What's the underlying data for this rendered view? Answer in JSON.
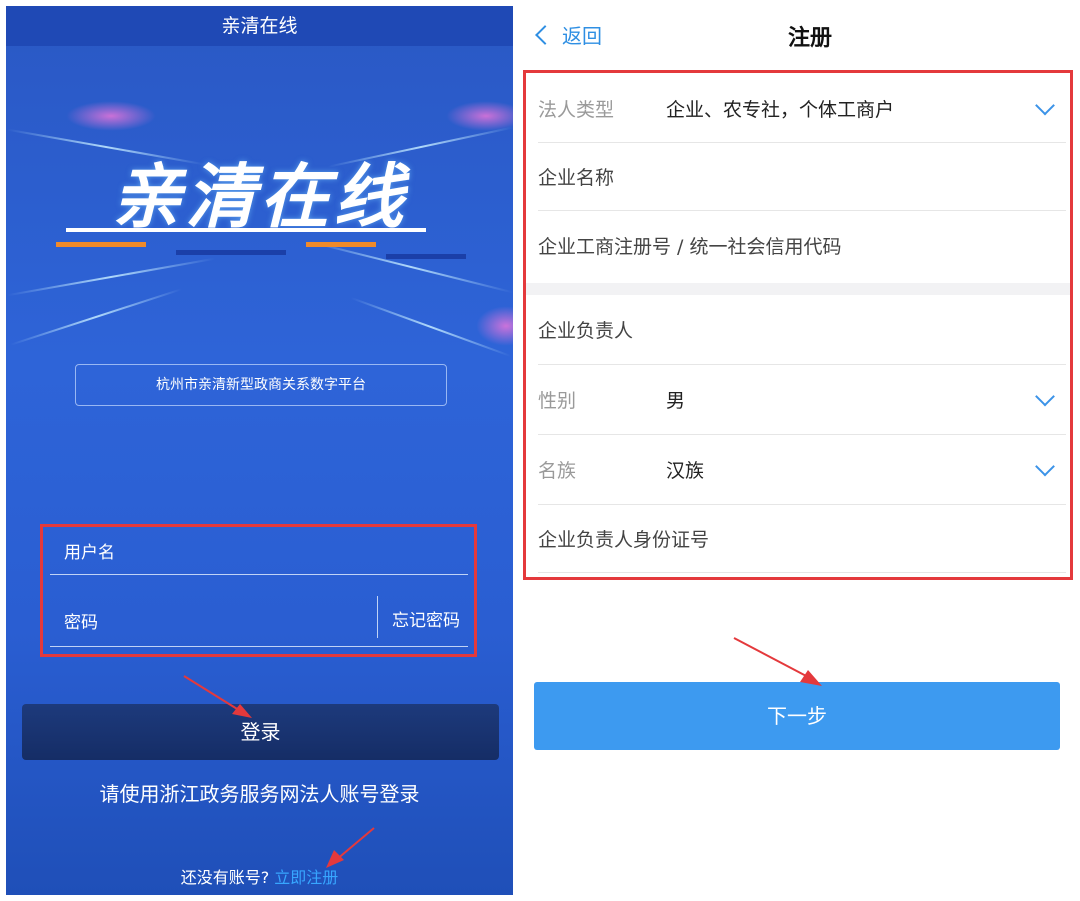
{
  "left": {
    "title_bar": "亲清在线",
    "logo_text": "亲清在线",
    "platform_name": "杭州市亲清新型政商关系数字平台",
    "username_placeholder": "用户名",
    "password_placeholder": "密码",
    "forgot_password": "忘记密码",
    "login_button": "登录",
    "hint": "请使用浙江政务服务网法人账号登录",
    "no_account": "还没有账号?",
    "register_now": "立即注册"
  },
  "right": {
    "back_label": "返回",
    "title": "注册",
    "rows": [
      {
        "label": "法人类型",
        "value": "企业、农专社，个体工商户",
        "dropdown": true
      },
      {
        "label": "企业名称",
        "value": "",
        "dropdown": false
      },
      {
        "label": "企业工商注册号 / 统一社会信用代码",
        "value": "",
        "dropdown": false
      },
      {
        "label": "企业负责人",
        "value": "",
        "dropdown": false
      },
      {
        "label": "性别",
        "value": "男",
        "dropdown": true
      },
      {
        "label": "名族",
        "value": "汉族",
        "dropdown": true
      },
      {
        "label": "企业负责人身份证号",
        "value": "",
        "dropdown": false
      }
    ],
    "next_button": "下一步"
  },
  "colors": {
    "highlight_red": "#e4393c",
    "accent_blue": "#3d9af0",
    "link_blue": "#37a6ff",
    "login_bg": "#2e64d8"
  }
}
